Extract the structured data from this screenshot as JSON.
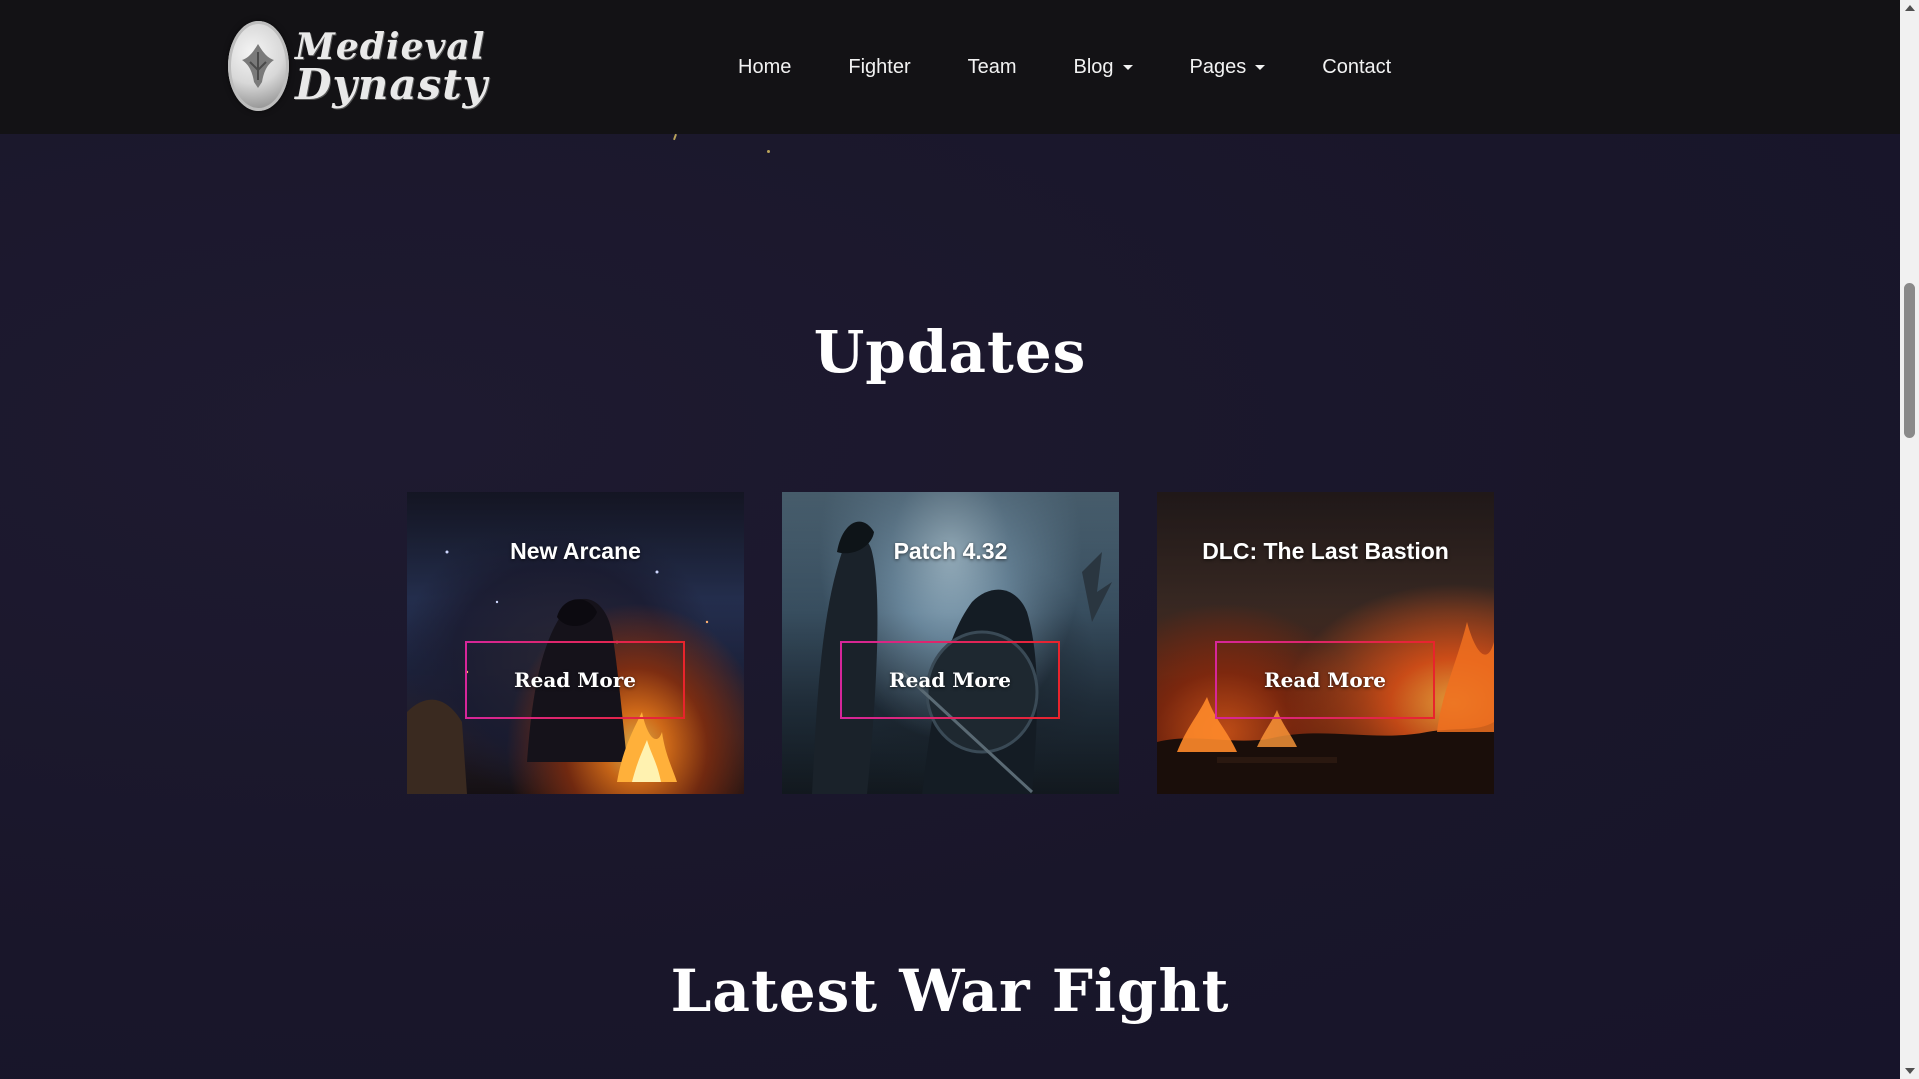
{
  "brand": {
    "line1": "Medieval",
    "line2": "Dynasty"
  },
  "nav": {
    "items": [
      {
        "label": "Home",
        "dropdown": false
      },
      {
        "label": "Fighter",
        "dropdown": false
      },
      {
        "label": "Team",
        "dropdown": false
      },
      {
        "label": "Blog",
        "dropdown": true
      },
      {
        "label": "Pages",
        "dropdown": true
      },
      {
        "label": "Contact",
        "dropdown": false
      }
    ]
  },
  "updates": {
    "title": "Updates",
    "cards": [
      {
        "title": "New Arcane",
        "button": "Read More"
      },
      {
        "title": "Patch 4.32",
        "button": "Read More"
      },
      {
        "title": "DLC: The Last Bastion",
        "button": "Read More"
      }
    ]
  },
  "war": {
    "title": "Latest War Fight"
  },
  "colors": {
    "background": "#1a1628",
    "navbar": "#131215",
    "button_border_start": "#d6269a",
    "button_border_end": "#e8242c"
  }
}
